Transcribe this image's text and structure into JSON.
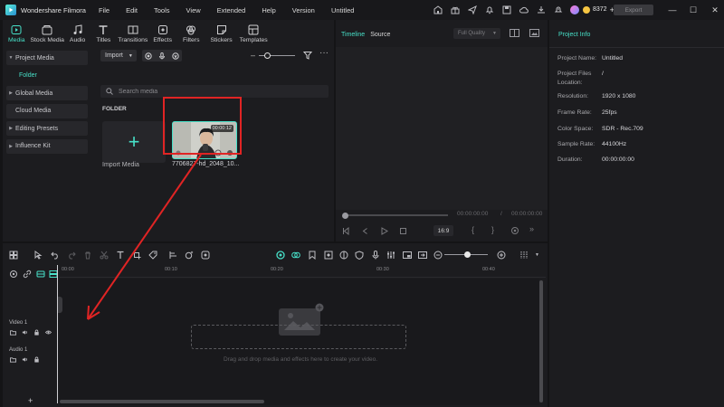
{
  "app": {
    "name": "Wondershare Filmora",
    "document_title": "Untitled"
  },
  "menu": [
    "File",
    "Edit",
    "Tools",
    "View",
    "Extended",
    "Help",
    "Version"
  ],
  "titlebar": {
    "credits": "8372",
    "credits_plus": "+",
    "export_label": "Export",
    "minimize": "—",
    "maximize": "☐",
    "close": "✕"
  },
  "top_tabs": [
    {
      "label": "Media",
      "icon": "media-icon",
      "active": true
    },
    {
      "label": "Stock Media",
      "icon": "stock-media-icon"
    },
    {
      "label": "Audio",
      "icon": "audio-icon"
    },
    {
      "label": "Titles",
      "icon": "titles-icon"
    },
    {
      "label": "Transitions",
      "icon": "transitions-icon"
    },
    {
      "label": "Effects",
      "icon": "effects-icon"
    },
    {
      "label": "Filters",
      "icon": "filters-icon"
    },
    {
      "label": "Stickers",
      "icon": "stickers-icon"
    },
    {
      "label": "Templates",
      "icon": "templates-icon"
    }
  ],
  "sidebar": {
    "items": [
      {
        "label": "Project Media",
        "expanded": true
      },
      {
        "label": "Folder",
        "selected": true
      },
      {
        "label": "Global Media",
        "expandable": true
      },
      {
        "label": "Cloud Media"
      },
      {
        "label": "Editing Presets",
        "expandable": true
      },
      {
        "label": "Influence Kit",
        "expandable": true
      }
    ]
  },
  "media": {
    "import_label": "Import",
    "search_placeholder": "Search media",
    "folder_heading": "FOLDER",
    "import_tile_label": "Import Media",
    "import_tile_plus": "+",
    "clip": {
      "name": "7706827-hd_2048_10...",
      "duration": "00:00:12"
    }
  },
  "player": {
    "tabs": [
      "Timeline",
      "Source"
    ],
    "quality": "Full Quality",
    "time_current": "00:00:00:00",
    "time_separator": "/",
    "time_total": "00:00:00:00",
    "ratio": "16:9"
  },
  "project_info": {
    "title": "Project Info",
    "rows": [
      {
        "label": "Project Name:",
        "value": "Untitled"
      },
      {
        "label": "Project Files Location:",
        "value": "/"
      },
      {
        "label": "Resolution:",
        "value": "1920 x 1080"
      },
      {
        "label": "Frame Rate:",
        "value": "25fps"
      },
      {
        "label": "Color Space:",
        "value": "SDR - Rec.709"
      },
      {
        "label": "Sample Rate:",
        "value": "44100Hz"
      },
      {
        "label": "Duration:",
        "value": "00:00:00:00"
      }
    ]
  },
  "timeline": {
    "ruler": [
      "00:00",
      "00:10",
      "00:20",
      "00:30",
      "00:40"
    ],
    "tracks": [
      {
        "name": "Video 1"
      },
      {
        "name": "Audio 1"
      }
    ],
    "drop_hint": "Drag and drop media and effects here to create your video.",
    "add_track": "+"
  },
  "colors": {
    "accent": "#47e0c8",
    "highlight": "#e02424"
  }
}
